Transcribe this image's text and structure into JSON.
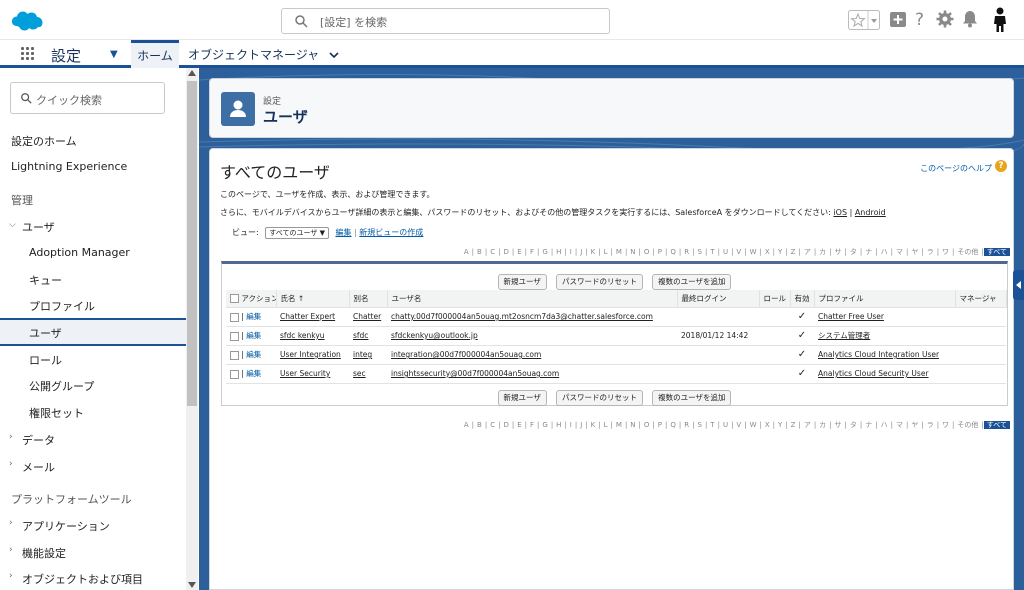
{
  "topbar": {
    "search_placeholder": "[設定] を検索"
  },
  "nav": {
    "app_title": "設定",
    "tabs": [
      "ホーム",
      "オブジェクトマネージャ"
    ]
  },
  "sidebar": {
    "quick_search_placeholder": "クイック検索",
    "items": [
      "設定のホーム",
      "Lightning Experience",
      "管理",
      "ユーザ",
      "Adoption Manager",
      "キュー",
      "プロファイル",
      "ユーザ",
      "ロール",
      "公開グループ",
      "権限セット",
      "データ",
      "メール",
      "プラットフォームツール",
      "アプリケーション",
      "機能設定",
      "オブジェクトおよび項目"
    ]
  },
  "header": {
    "small": "設定",
    "title": "ユーザ"
  },
  "page": {
    "title": "すべてのユーザ",
    "help": "このページのヘルプ",
    "help_icon": "?",
    "desc1": "このページで、ユーザを作成、表示、および管理できます。",
    "desc2": "さらに、モバイルデバイスからユーザ詳細の表示と編集、パスワードのリセット、およびその他の管理タスクを実行するには、SalesforceA をダウンロードしてください:",
    "ios": "iOS",
    "sep": "|",
    "android": "Android",
    "view_label": "ビュー:",
    "view_value": "すべてのユーザ ▼",
    "edit_link": "編集",
    "new_view_link": "新規ビューの作成",
    "alphabet": [
      "A",
      "B",
      "C",
      "D",
      "E",
      "F",
      "G",
      "H",
      "I",
      "J",
      "K",
      "L",
      "M",
      "N",
      "O",
      "P",
      "Q",
      "R",
      "S",
      "T",
      "U",
      "V",
      "W",
      "X",
      "Y",
      "Z",
      "ア",
      "カ",
      "サ",
      "タ",
      "ナ",
      "ハ",
      "マ",
      "ヤ",
      "ラ",
      "ワ",
      "その他",
      "すべて"
    ]
  },
  "buttons": {
    "new_user": "新規ユーザ",
    "reset_password": "パスワードのリセット",
    "add_multiple": "複数のユーザを追加"
  },
  "table": {
    "headers": [
      "アクション",
      "氏名 ↑",
      "別名",
      "ユーザ名",
      "最終ログイン",
      "ロール",
      "有効",
      "プロファイル",
      "マネージャ"
    ],
    "edit_label": "編集",
    "rows": [
      {
        "name": "Chatter Expert",
        "alias": "Chatter",
        "username": "chatty.00d7f000004an5ouag.mt2osncm7da3@chatter.salesforce.com",
        "last_login": "",
        "role": "",
        "active": "✓",
        "profile": "Chatter Free User",
        "manager": ""
      },
      {
        "name": "sfdc kenkyu",
        "alias": "sfdc",
        "username": "sfdckenkyu@outlook.jp",
        "last_login": "2018/01/12 14:42",
        "role": "",
        "active": "✓",
        "profile": "システム管理者",
        "manager": ""
      },
      {
        "name": "User Integration",
        "alias": "integ",
        "username": "integration@00d7f000004an5ouag.com",
        "last_login": "",
        "role": "",
        "active": "✓",
        "profile": "Analytics Cloud Integration User",
        "manager": ""
      },
      {
        "name": "User Security",
        "alias": "sec",
        "username": "insightssecurity@00d7f000004an5ouag.com",
        "last_login": "",
        "role": "",
        "active": "✓",
        "profile": "Analytics Cloud Security User",
        "manager": ""
      }
    ]
  },
  "colors": {
    "brand": "#1b5297",
    "header_bg": "#2d5f9a",
    "link": "#015ba7"
  }
}
